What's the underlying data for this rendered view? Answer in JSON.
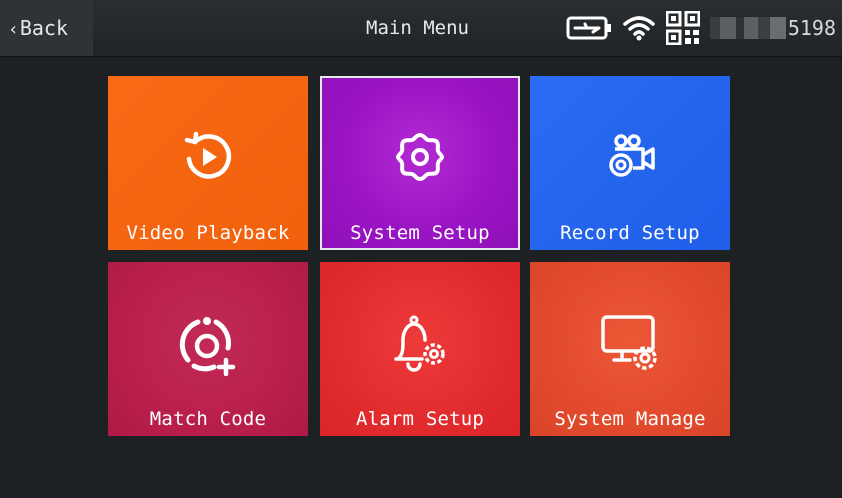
{
  "header": {
    "back_label": "Back",
    "title": "Main Menu",
    "device_id": "5198",
    "status_icons": [
      "battery-charging-icon",
      "wifi-icon",
      "qr-code-icon"
    ]
  },
  "menu": {
    "items": [
      {
        "label": "Video Playback",
        "icon": "playback-icon",
        "color": "#f2600c"
      },
      {
        "label": "System Setup",
        "icon": "gear-icon",
        "color": "#9b14c4",
        "selected": true
      },
      {
        "label": "Record Setup",
        "icon": "camera-record-icon",
        "color": "#1f5ee8"
      },
      {
        "label": "Match Code",
        "icon": "match-code-icon",
        "color": "#b91f4b"
      },
      {
        "label": "Alarm Setup",
        "icon": "alarm-bell-icon",
        "color": "#e12c2e"
      },
      {
        "label": "System Manage",
        "icon": "monitor-gear-icon",
        "color": "#e14a2d"
      }
    ]
  }
}
